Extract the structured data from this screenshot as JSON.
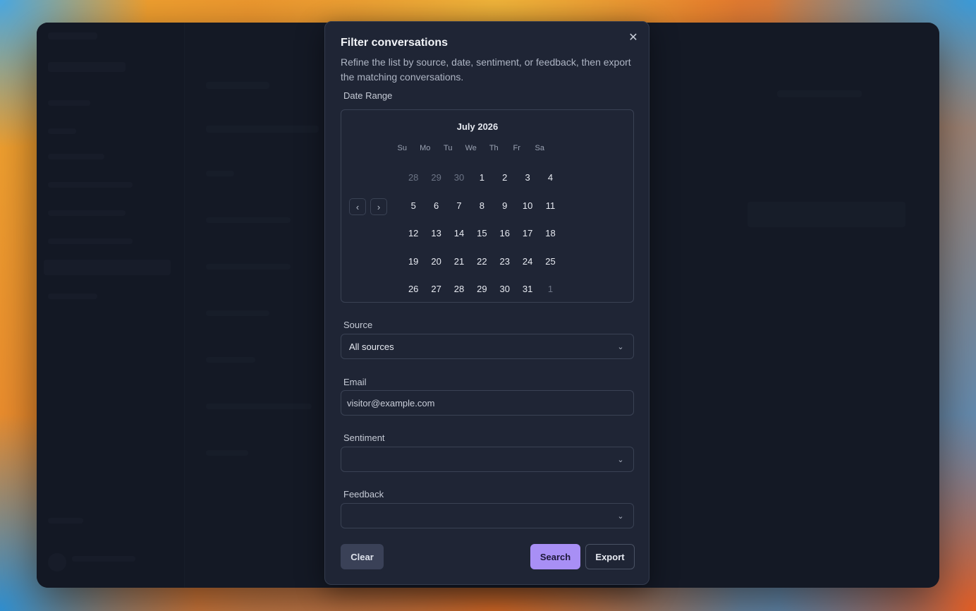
{
  "dialog": {
    "title": "Filter conversations",
    "description": "Refine the list by source, date, sentiment, or feedback, then export the matching conversations.",
    "close_glyph": "✕"
  },
  "date_range": {
    "label": "Date Range",
    "month": "July 2026",
    "prev_glyph": "‹",
    "next_glyph": "›",
    "weekdays": [
      "Su",
      "Mo",
      "Tu",
      "We",
      "Th",
      "Fr",
      "Sa"
    ],
    "days": [
      {
        "label": "28",
        "outside": true
      },
      {
        "label": "29",
        "outside": true
      },
      {
        "label": "30",
        "outside": true
      },
      {
        "label": "1"
      },
      {
        "label": "2"
      },
      {
        "label": "3"
      },
      {
        "label": "4"
      },
      {
        "label": "5"
      },
      {
        "label": "6"
      },
      {
        "label": "7"
      },
      {
        "label": "8"
      },
      {
        "label": "9"
      },
      {
        "label": "10"
      },
      {
        "label": "11"
      },
      {
        "label": "12"
      },
      {
        "label": "13"
      },
      {
        "label": "14"
      },
      {
        "label": "15"
      },
      {
        "label": "16"
      },
      {
        "label": "17"
      },
      {
        "label": "18"
      },
      {
        "label": "19"
      },
      {
        "label": "20"
      },
      {
        "label": "21"
      },
      {
        "label": "22"
      },
      {
        "label": "23"
      },
      {
        "label": "24"
      },
      {
        "label": "25"
      },
      {
        "label": "26"
      },
      {
        "label": "27"
      },
      {
        "label": "28"
      },
      {
        "label": "29"
      },
      {
        "label": "30"
      },
      {
        "label": "31"
      },
      {
        "label": "1",
        "outside": true
      }
    ]
  },
  "source": {
    "label": "Source",
    "value": "All sources"
  },
  "email": {
    "label": "Email",
    "placeholder": "visitor@example.com"
  },
  "sentiment": {
    "label": "Sentiment",
    "value": ""
  },
  "feedback": {
    "label": "Feedback",
    "value": ""
  },
  "chevron_glyph": "⌄",
  "actions": {
    "clear": "Clear",
    "search": "Search",
    "export": "Export"
  },
  "colors": {
    "accent": "#a88ff5",
    "dialog_bg": "#1f2535",
    "border": "#3a4254"
  }
}
